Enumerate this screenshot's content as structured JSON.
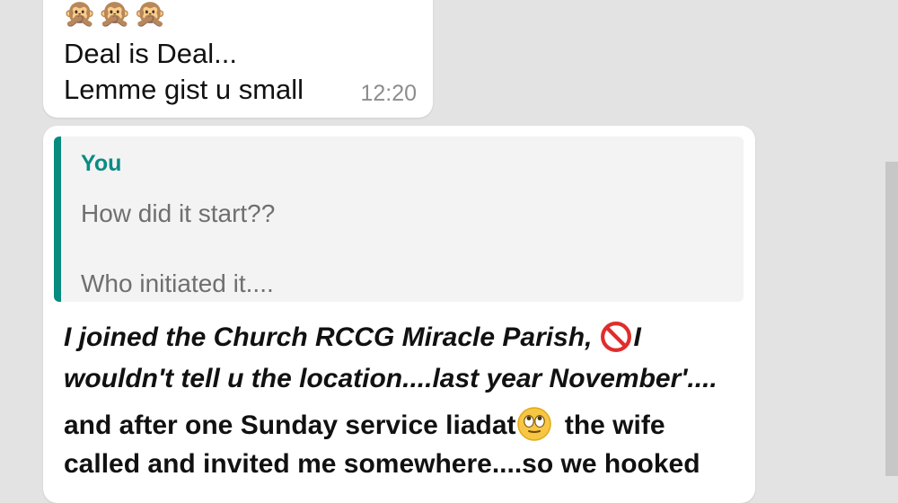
{
  "messages": [
    {
      "emoji": "🙊🙊🙊",
      "lines": [
        "Deal is Deal...",
        "Lemme gist u small"
      ],
      "time": "12:20"
    },
    {
      "reply": {
        "author": "You",
        "lines": [
          "How did it start??",
          "Who initiated it...."
        ]
      },
      "body": {
        "line1_part1": "I joined the Church RCCG Miracle Parish,",
        "line1_part2": "I",
        "line2": "wouldn't tell u the location....last year November'....",
        "line3_part1": "and after one Sunday service liadat",
        "line3_part2": " the wife",
        "line4": "called and invited me somewhere....so we hooked"
      }
    }
  ],
  "colors": {
    "background": "#e3e3e3",
    "bubble": "#ffffff",
    "quote_bar": "#078b7e",
    "quote_author": "#0b8c82",
    "timestamp": "#8d8d8d"
  },
  "icons": {
    "no_entry": "no-entry-icon",
    "rolling_eyes": "rolling-eyes-emoji"
  }
}
